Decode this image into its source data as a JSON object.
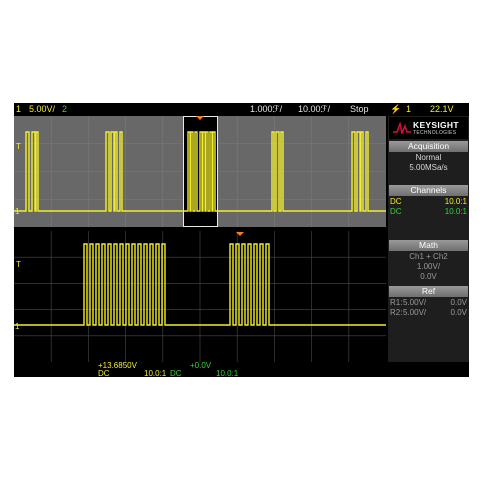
{
  "topbar": {
    "ch1_num": "1",
    "ch1_scale": "5.00V/",
    "ch2_num": "2",
    "timebase": "1.000ℱ/",
    "delay": "10.00ℱ/",
    "run_state": "Stop",
    "trigger_icon": "lightning-trigger-icon",
    "trigger_channel": "1",
    "trigger_level": "22.1V"
  },
  "side": {
    "brand": "KEYSIGHT",
    "brand_sub": "TECHNOLOGIES",
    "acquisition": {
      "title": "Acquisition",
      "mode": "Normal",
      "rate": "5.00MSa/s"
    },
    "channels": {
      "title": "Channels",
      "rows": [
        {
          "coupling": "DC",
          "ratio": "10.0:1"
        },
        {
          "coupling": "DC",
          "ratio": "10.0:1"
        }
      ]
    },
    "math": {
      "title": "Math",
      "expr": "Ch1 + Ch2",
      "scale": "1.00V/",
      "offset": "0.0V"
    },
    "ref": {
      "title": "Ref",
      "r1_label": "R1:",
      "r1_scale": "5.00V/",
      "r1_offset": "0.0V",
      "r2_label": "R2:",
      "r2_scale": "5.00V/",
      "r2_offset": "0.0V"
    }
  },
  "bottom": {
    "ch1_offset": "+13.6850V",
    "ch2_offset": "+0.0V",
    "ch1_coupling": "DC",
    "ch1_ratio": "10.0:1",
    "ch2_coupling": "DC",
    "ch2_ratio": "10.0:1"
  },
  "markers": {
    "ground_ch1": "1",
    "trigger_t": "T",
    "ground_ch2": "1"
  },
  "colors": {
    "ch1": "#f2ee2e",
    "ch2": "#38d038",
    "grid": "#5a5a5a",
    "overview_bg": "#676767",
    "trigger": "#ff7a1a",
    "brand_red": "#d0103a"
  }
}
